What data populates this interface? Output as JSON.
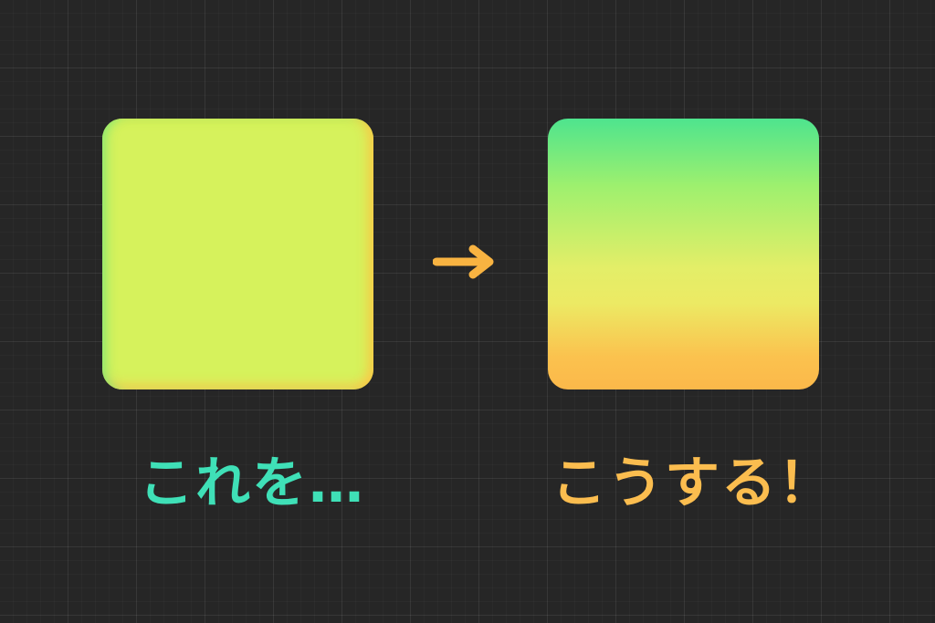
{
  "before": {
    "caption": "これを…",
    "caption_color": "#3fe0b7",
    "box_fill": "#d6f25c",
    "edge_colors": [
      "#78e678",
      "#fac846"
    ]
  },
  "arrow": {
    "icon": "arrow-right-icon",
    "color": "#f8b341"
  },
  "after": {
    "caption": "こうする！",
    "caption_color": "#fbbd4f",
    "gradient_stops": [
      "#4ee48e",
      "#9ef06e",
      "#e3ee68",
      "#ecea64",
      "#fbc24e",
      "#fbb84a"
    ]
  },
  "background": {
    "color": "#262626",
    "grid": true
  }
}
